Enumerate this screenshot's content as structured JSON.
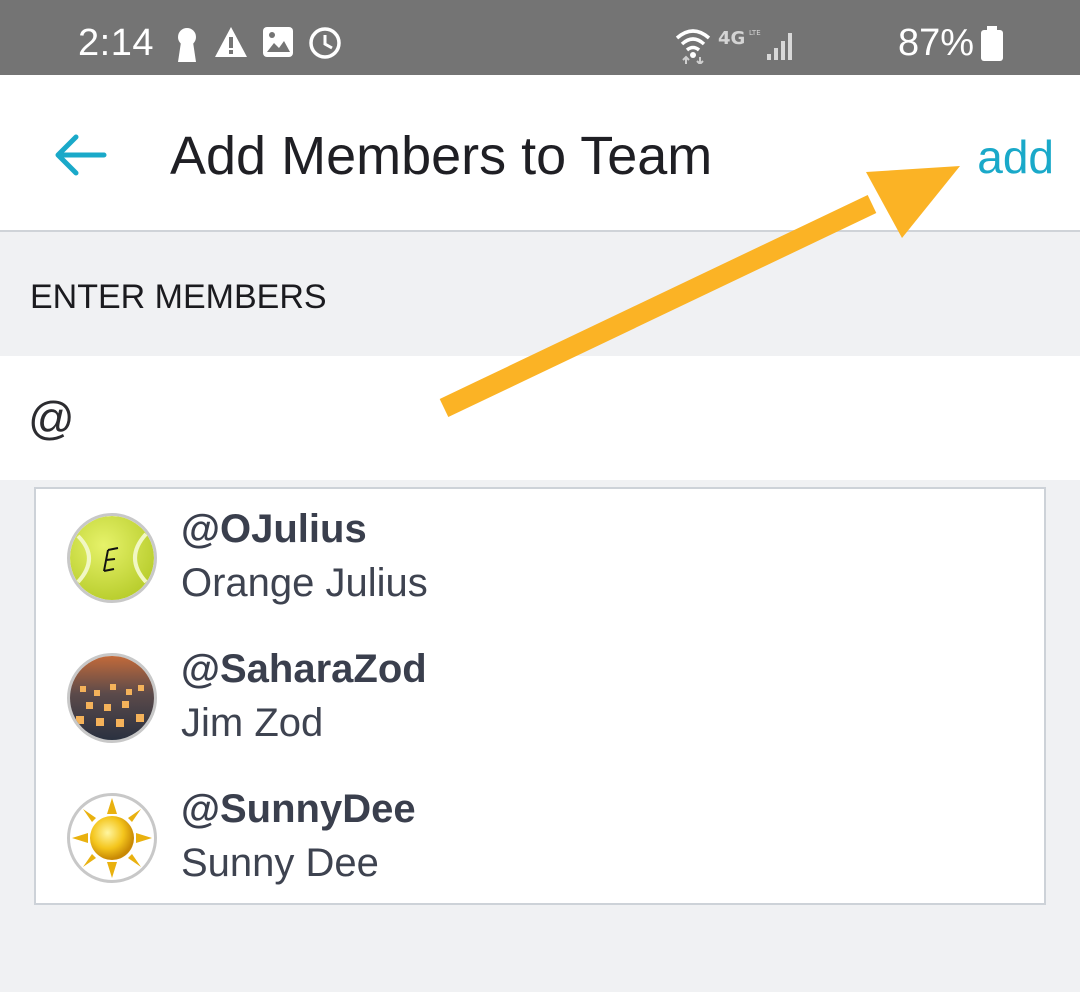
{
  "status_bar": {
    "time": "2:14",
    "battery_percent": "87%",
    "icons_left": [
      "keyhole-icon",
      "warning-icon",
      "image-icon",
      "clock-icon"
    ],
    "icons_right": [
      "wifi-icon",
      "4g-lte-icon",
      "signal-icon",
      "battery-icon"
    ]
  },
  "header": {
    "back_icon": "arrow-left-icon",
    "title": "Add Members to Team",
    "add_label": "add"
  },
  "form": {
    "section_label": "ENTER MEMBERS",
    "input_value": "@"
  },
  "suggestions": [
    {
      "handle": "@OJulius",
      "name": "Orange Julius",
      "avatar": "tennis-ball-avatar"
    },
    {
      "handle": "@SaharaZod",
      "name": "Jim Zod",
      "avatar": "lanterns-avatar"
    },
    {
      "handle": "@SunnyDee",
      "name": "Sunny Dee",
      "avatar": "sun-avatar"
    }
  ],
  "annotation": {
    "arrow_color": "#fbb325"
  },
  "colors": {
    "accent": "#1aa9c9",
    "status_bar": "#747474",
    "background": "#f0f1f3"
  }
}
